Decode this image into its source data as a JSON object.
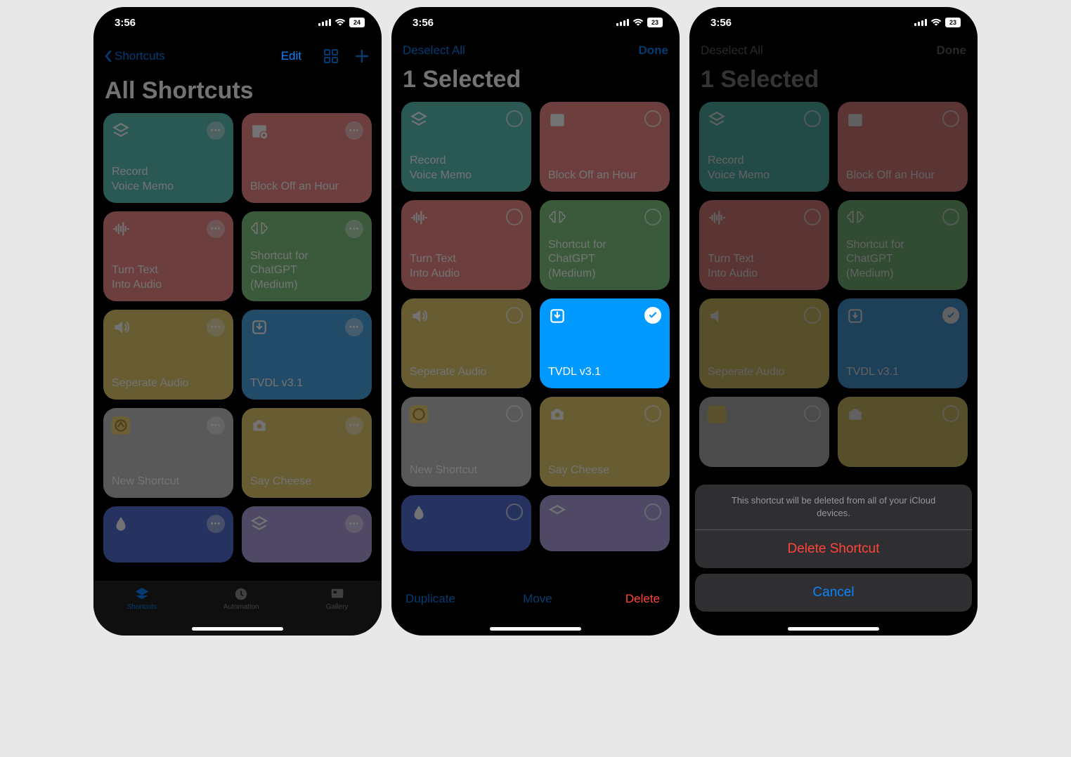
{
  "status": {
    "time": "3:56"
  },
  "battery": {
    "s1": "24",
    "s2": "23",
    "s3": "23"
  },
  "screen1": {
    "back": "Shortcuts",
    "edit": "Edit",
    "title": "All Shortcuts",
    "tabs": {
      "shortcuts": "Shortcuts",
      "automation": "Automation",
      "gallery": "Gallery"
    }
  },
  "screen2": {
    "deselect": "Deselect All",
    "done": "Done",
    "title": "1 Selected",
    "duplicate": "Duplicate",
    "move": "Move",
    "delete": "Delete"
  },
  "screen3": {
    "deselect": "Deselect All",
    "done": "Done",
    "title": "1 Selected",
    "sheet_msg": "This shortcut will be deleted from all of your iCloud devices.",
    "delete": "Delete Shortcut",
    "cancel": "Cancel"
  },
  "tiles": {
    "record": "Record\nVoice Memo",
    "block": "Block Off an Hour",
    "turntext": "Turn Text\nInto Audio",
    "chatgpt": "Shortcut for\nChatGPT\n(Medium)",
    "seperate": "Seperate Audio",
    "tvdl": "TVDL v3.1",
    "newshortcut": "New Shortcut",
    "saycheese": "Say Cheese"
  }
}
